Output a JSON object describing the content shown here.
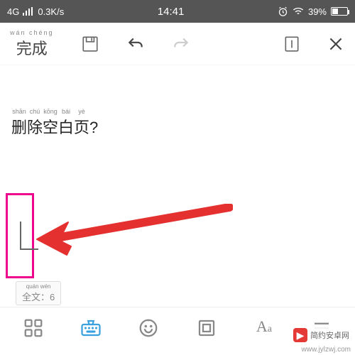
{
  "status": {
    "network_type": "4G",
    "speed": "0.3K/s",
    "time": "14:41",
    "battery_pct": "39%"
  },
  "toolbar": {
    "done_pinyin": "wán chéng",
    "done_label": "完成"
  },
  "content": {
    "pinyin": {
      "c1": "shān",
      "c2": "chú",
      "c3": "kōng",
      "c4": "bái",
      "c5": "yè"
    },
    "text": "删除空白页?"
  },
  "footer": {
    "label_pinyin": "quán wén",
    "label": "全文：6"
  },
  "watermark": {
    "site_name": "简约安卓网",
    "url": "www.jylzwj.com"
  }
}
